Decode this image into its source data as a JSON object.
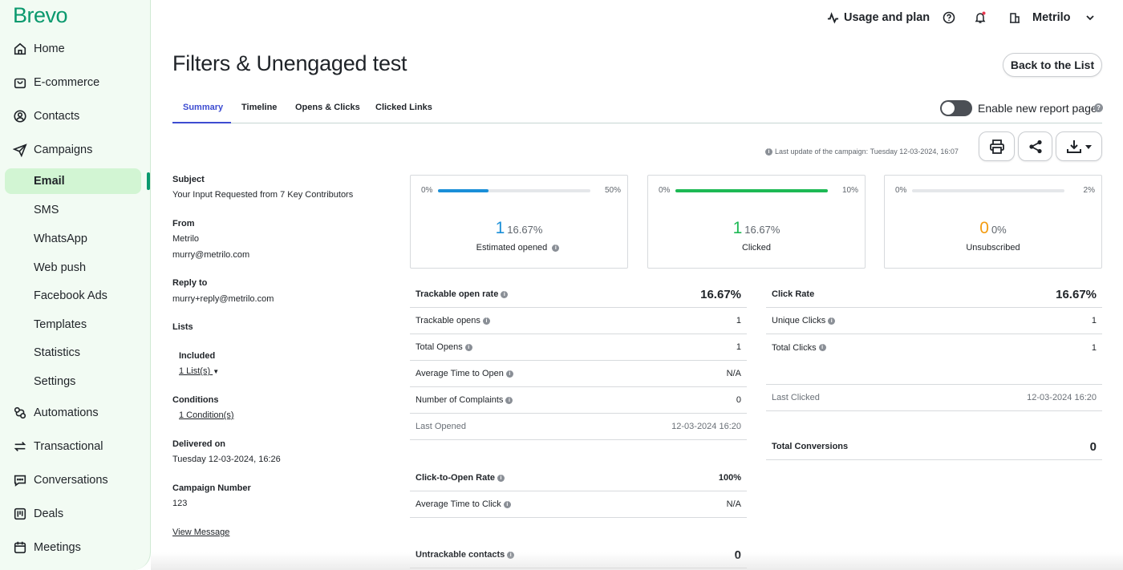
{
  "brand": {
    "logo": "Brevo",
    "accent": "#0b996e",
    "active_bg": "#d2f5d3"
  },
  "sidebar": {
    "home": "Home",
    "ecommerce": "E-commerce",
    "contacts": "Contacts",
    "campaigns": "Campaigns",
    "email": "Email",
    "sms": "SMS",
    "whatsapp": "WhatsApp",
    "webpush": "Web push",
    "facebook": "Facebook Ads",
    "templates": "Templates",
    "statistics": "Statistics",
    "settings": "Settings",
    "automations": "Automations",
    "transactional": "Transactional",
    "conversations": "Conversations",
    "deals": "Deals",
    "meetings": "Meetings"
  },
  "header": {
    "usage": "Usage and plan",
    "account": "Metrilo",
    "title": "Filters & Unengaged test",
    "back": "Back to the List"
  },
  "tabs": {
    "summary": "Summary",
    "timeline": "Timeline",
    "opens_clicks": "Opens & Clicks",
    "clicked_links": "Clicked Links"
  },
  "toggle": {
    "label": "Enable new report page",
    "on": false
  },
  "last_update": {
    "label": "Last update of the campaign:",
    "value": "Tuesday 12-03-2024, 16:07"
  },
  "details": {
    "subject_label": "Subject",
    "subject": "Your Input Requested from 7 Key Contributors",
    "from_label": "From",
    "from_name": "Metrilo",
    "from_email": "murry@metrilo.com",
    "reply_label": "Reply to",
    "reply": "murry+reply@metrilo.com",
    "lists_label": "Lists",
    "included_label": "Included",
    "lists_link": "1 List(s)",
    "conditions_label": "Conditions",
    "conditions_link": "1 Condition(s)",
    "delivered_label": "Delivered on",
    "delivered": "Tuesday 12-03-2024, 16:26",
    "number_label": "Campaign Number",
    "number": "123",
    "view_message": "View Message"
  },
  "cards": [
    {
      "min": "0%",
      "max": "50%",
      "count": "1",
      "pct": "16.67%",
      "label": "Estimated opened",
      "color": "#1a8fd8",
      "fill": 0.3334
    },
    {
      "min": "0%",
      "max": "10%",
      "count": "1",
      "pct": "16.67%",
      "label": "Clicked",
      "color": "#1db954",
      "fill": 1.0
    },
    {
      "min": "0%",
      "max": "2%",
      "count": "0",
      "pct": "0%",
      "label": "Unsubscribed",
      "color": "#f39c12",
      "fill": 0
    }
  ],
  "open_metrics": {
    "rate_label": "Trackable open rate",
    "rate": "16.67%",
    "opens_label": "Trackable opens",
    "opens": "1",
    "total_label": "Total Opens",
    "total": "1",
    "avg_label": "Average Time to Open",
    "avg": "N/A",
    "complaints_label": "Number of Complaints",
    "complaints": "0",
    "last_label": "Last Opened",
    "last": "12-03-2024 16:20"
  },
  "click_metrics": {
    "rate_label": "Click Rate",
    "rate": "16.67%",
    "unique_label": "Unique Clicks",
    "unique": "1",
    "total_label": "Total Clicks",
    "total": "1",
    "last_label": "Last Clicked",
    "last": "12-03-2024 16:20",
    "conv_label": "Total Conversions",
    "conv": "0"
  },
  "cto": {
    "rate_label": "Click-to-Open Rate",
    "rate": "100%",
    "avg_label": "Average Time to Click",
    "avg": "N/A",
    "untrack_label": "Untrackable contacts",
    "untrack": "0"
  }
}
